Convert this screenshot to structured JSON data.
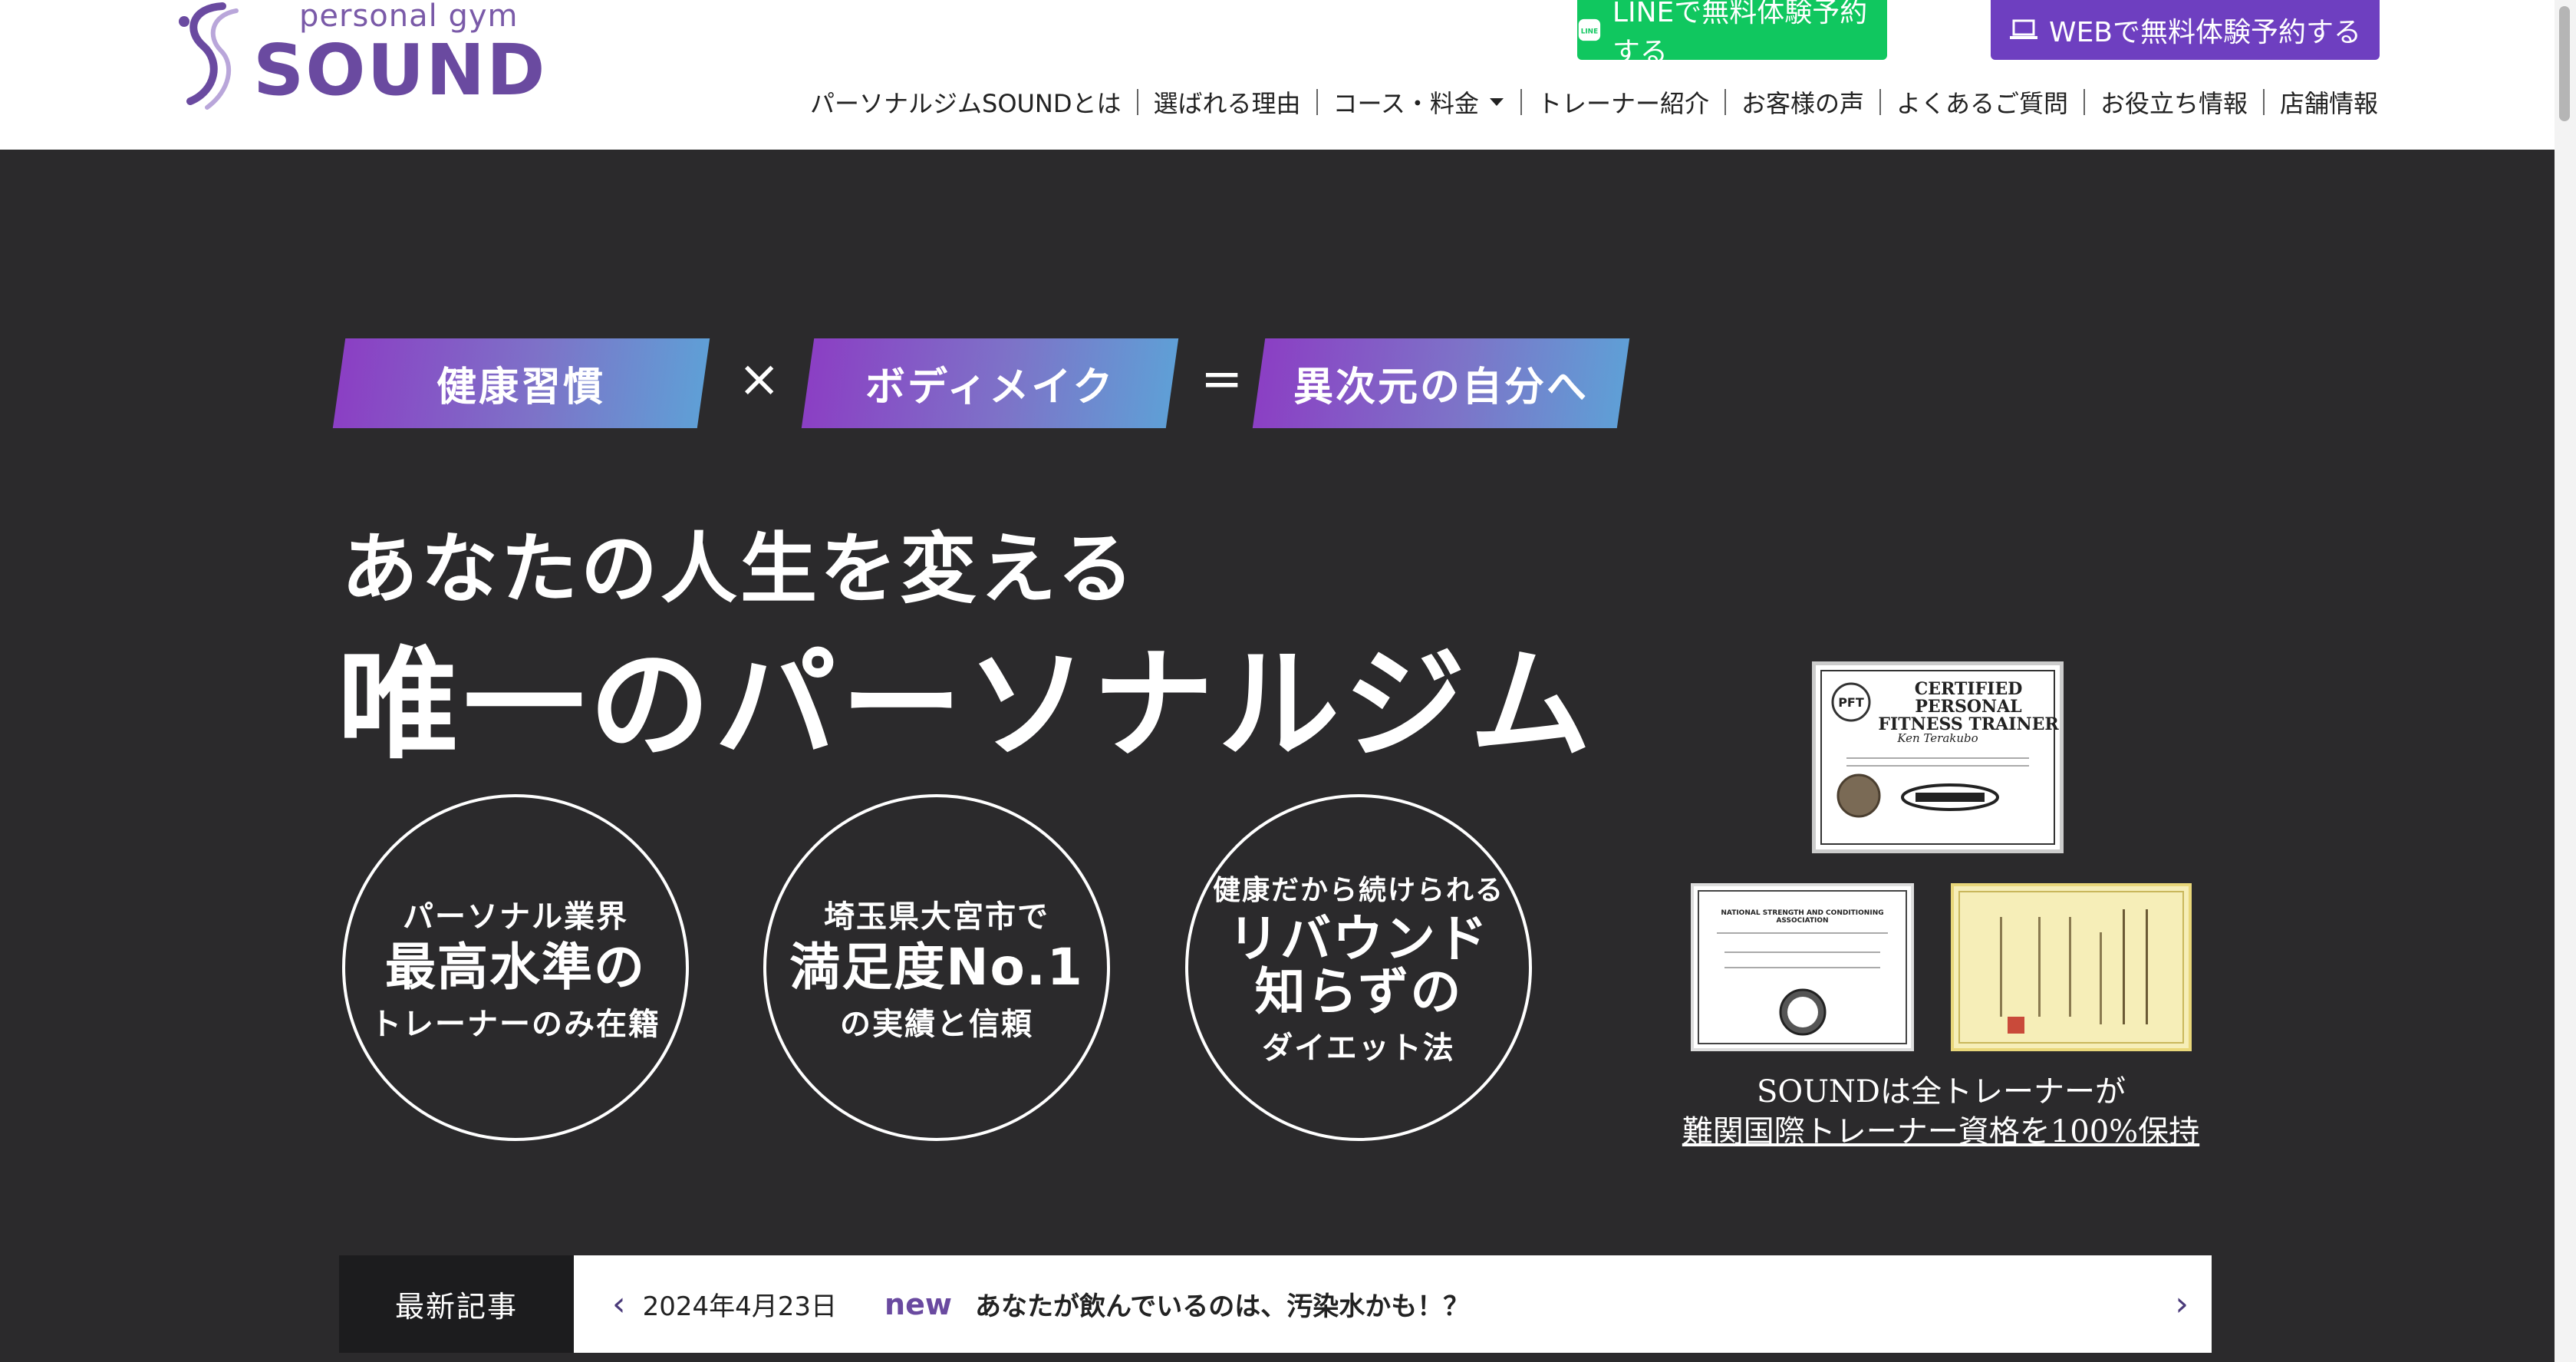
{
  "brand": {
    "sub": "personal gym",
    "name": "SOUND",
    "accent_color": "#6a4aa0"
  },
  "header": {
    "cta_line": {
      "icon": "line-icon",
      "label": "LINEで無料体験予約する",
      "color": "#10c75f"
    },
    "cta_web": {
      "icon": "laptop-icon",
      "label": "WEBで無料体験予約する",
      "color": "#6e3fc0"
    },
    "nav": [
      {
        "label": "パーソナルジムSOUNDとは"
      },
      {
        "label": "選ばれる理由"
      },
      {
        "label": "コース・料金",
        "dropdown": true,
        "icon": "caret-down-icon"
      },
      {
        "label": "トレーナー紹介"
      },
      {
        "label": "お客様の声"
      },
      {
        "label": "よくあるご質問"
      },
      {
        "label": "お役立ち情報"
      },
      {
        "label": "店舗情報"
      }
    ]
  },
  "hero": {
    "tags": [
      "健康習慣",
      "ボディメイク",
      "異次元の自分へ"
    ],
    "operators": [
      "×",
      "="
    ],
    "headline_1": "あなたの人生を変える",
    "headline_2": "唯一のパーソナルジム",
    "circles": [
      {
        "top": "パーソナル業界",
        "main": "最高水準の",
        "bottom": "トレーナーのみ在籍"
      },
      {
        "top": "埼玉県大宮市で",
        "main": "満足度No.1",
        "bottom": "の実績と信頼"
      },
      {
        "top": "健康だから続けられる",
        "main": "リバウンド\n知らずの",
        "bottom": "ダイエット法"
      }
    ],
    "certificates": {
      "pft_title": "CERTIFIED PERSONAL FITNESS TRAINER",
      "pft_name": "Ken Terakubo",
      "nsca_title": "NATIONAL STRENGTH AND CONDITIONING ASSOCIATION",
      "caption_1": "SOUNDは全トレーナーが",
      "caption_2": "難関国際トレーナー資格を100%保持"
    }
  },
  "news": {
    "label": "最新記事",
    "date": "2024年4月23日",
    "badge": "new",
    "title": "あなたが飲んでいるのは、汚染水かも！？"
  },
  "colors": {
    "hero_bg": "#2b2a2c",
    "news_label_bg": "#1c1c1e"
  }
}
